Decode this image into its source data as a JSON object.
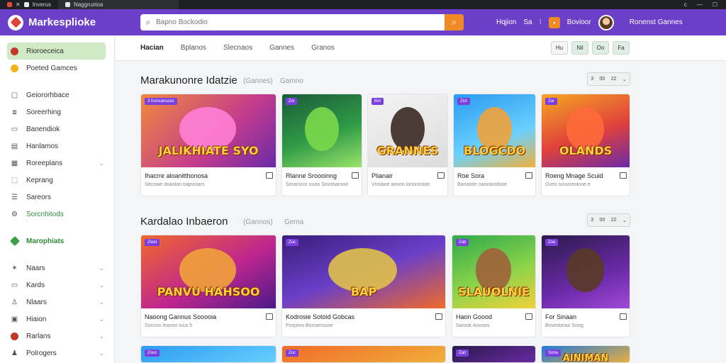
{
  "browser": {
    "tabs": [
      {
        "label": "Inverus"
      },
      {
        "label": "Naggrustoa"
      }
    ],
    "window_controls": [
      "c",
      "—",
      "☐"
    ]
  },
  "header": {
    "app_name": "Markesplioke",
    "search_placeholder": "Bapno Bockodio",
    "nav_primary": "Hqjion",
    "nav_secondary": "Sa",
    "nav_game": "Bovioor",
    "account_label": "Ronenst Gannes",
    "accent_color": "#6c3fc8",
    "button_color": "#f08a24"
  },
  "sidebar": {
    "items": [
      {
        "label": "Rioroeceica",
        "icon": "coin-icon",
        "active": true
      },
      {
        "label": "Poeted Gamces",
        "icon": "gold-coin-icon"
      },
      {
        "label": "Geiororhbace",
        "icon": "bag-icon"
      },
      {
        "label": "Soreerhing",
        "icon": "box-icon"
      },
      {
        "label": "Banendiok",
        "icon": "monitor-icon"
      },
      {
        "label": "Hanlamos",
        "icon": "note-icon"
      },
      {
        "label": "Roreeplans",
        "icon": "plan-icon",
        "chevron": "⌄"
      },
      {
        "label": "Keprang",
        "icon": "tag-icon"
      },
      {
        "label": "Sareors",
        "icon": "sliders-icon"
      },
      {
        "label": "Sorcnhitods",
        "icon": "gear-icon",
        "green": true
      },
      {
        "label": "Marophiats",
        "icon": "diamond-icon",
        "green": true
      },
      {
        "label": "Naars",
        "icon": "pin-icon",
        "chevron": "⌄"
      },
      {
        "label": "Kards",
        "icon": "card-icon",
        "chevron": "⌄"
      },
      {
        "label": "Nlaars",
        "icon": "user-icon",
        "chevron": "⌄"
      },
      {
        "label": "Hiaion",
        "icon": "calendar-icon",
        "chevron": "⌄"
      },
      {
        "label": "Rarlans",
        "icon": "record-icon",
        "chevron": "⌄"
      },
      {
        "label": "Polrogers",
        "icon": "people-icon",
        "chevron": "⌄"
      }
    ]
  },
  "subnav": {
    "tabs": [
      "Hacian",
      "Bplanos",
      "Slecnaos",
      "Gannes",
      "Granos"
    ],
    "tools": [
      "Hu",
      "Nil",
      "Oo",
      "Fa"
    ]
  },
  "sections": [
    {
      "title": "Marakunonre Idatzie",
      "subtitle": "(Gannes)",
      "subtitle2": "Gamno",
      "pager": [
        "3",
        "00",
        "22",
        "⌄"
      ],
      "cards": [
        {
          "badge": "3 Koncansces",
          "title": "Ihacrre aloanitthonosa",
          "meta": "Secoiae doaolan bapvioars",
          "art": "JALIKHIATE SYO"
        },
        {
          "badge": "Zoi",
          "title": "Rlanne Sroooinng",
          "meta": "Sorarocor ouoo Sovobarood",
          "art": ""
        },
        {
          "badge": "Bot",
          "title": "Plianair",
          "meta": "Vnolaoe aovoo lonororooe",
          "art": "GRANNES"
        },
        {
          "badge": "Ziol",
          "title": "Roe Sora",
          "meta": "Banolote naovaordvoe",
          "art": "BLOGCDO"
        },
        {
          "badge": "Zar",
          "title": "Roeng Mnage Scuid",
          "meta": "Oveo sovvoeolooe e",
          "art": "OLANDS"
        }
      ]
    },
    {
      "title": "Kardalao Inbaeron",
      "subtitle": "(Gannos)",
      "subtitle2": "Gema",
      "pager": [
        "3",
        "00",
        "22",
        "⌄"
      ],
      "cards": [
        {
          "badge": "Zioel",
          "title": "Naoong Gannus Sooooia",
          "meta": "Socoos leaooo loca 5",
          "art": "PANVU HAHSOO"
        },
        {
          "badge": "Zuc",
          "title": "Kodrosie Sotoid Gobcas",
          "meta": "Porpovo Bocoenssoe",
          "art": "BAP"
        },
        {
          "badge": "Zab",
          "title": "Haon Goood",
          "meta": "Sarook Aoooirs",
          "art": "SLAUOLNIE"
        },
        {
          "badge": "Zoe",
          "title": "For Sinaan",
          "meta": "Bovedoriao Soog",
          "art": ""
        }
      ]
    }
  ],
  "row3_badges": [
    "Zouc",
    "Zoc",
    "Zan",
    "Sona"
  ],
  "row3_art": [
    "",
    "",
    "",
    "AINIMAN"
  ]
}
